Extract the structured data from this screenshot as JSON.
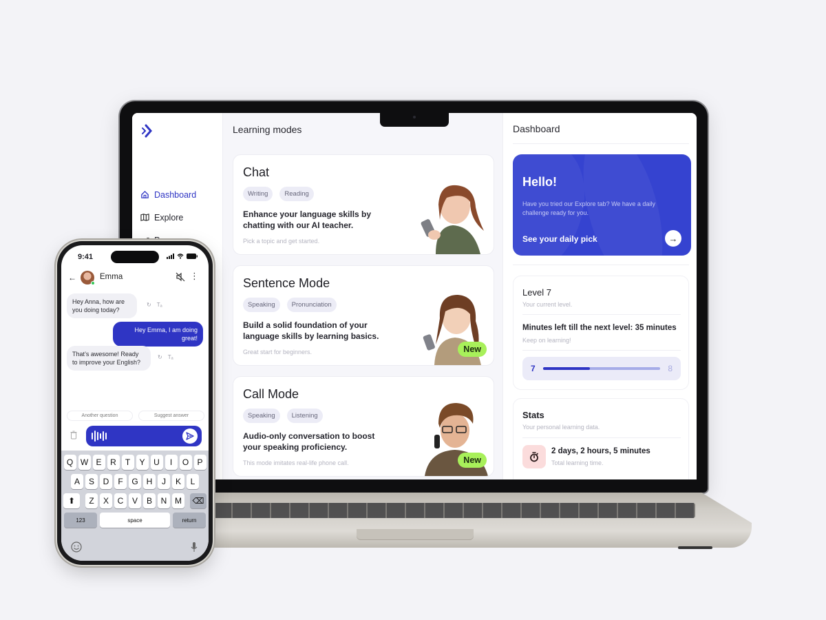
{
  "laptop": {
    "sidebar": {
      "logo": "app-logo",
      "items": [
        {
          "label": "Dashboard",
          "icon": "home-icon",
          "active": true
        },
        {
          "label": "Explore",
          "icon": "map-icon",
          "active": false
        },
        {
          "label": "Progress",
          "icon": "trend-up-icon",
          "active": false
        }
      ]
    },
    "learning_modes": {
      "title": "Learning modes",
      "cards": [
        {
          "title": "Chat",
          "tags": [
            "Writing",
            "Reading"
          ],
          "description": "Enhance your language skills by chatting with our AI teacher.",
          "hint": "Pick a topic and get started.",
          "badge": null
        },
        {
          "title": "Sentence Mode",
          "tags": [
            "Speaking",
            "Pronunciation"
          ],
          "description": "Build a solid foundation of your language skills by learning basics.",
          "hint": "Great start for beginners.",
          "badge": "New"
        },
        {
          "title": "Call Mode",
          "tags": [
            "Speaking",
            "Listening"
          ],
          "description": "Audio-only conversation to boost your speaking proficiency.",
          "hint": "This mode imitates real-life phone call.",
          "badge": "New"
        }
      ]
    },
    "dashboard": {
      "title": "Dashboard",
      "hello": {
        "title": "Hello!",
        "text": "Have you tried our Explore tab? We have a daily challenge ready for you.",
        "cta": "See your daily pick",
        "arrow": "→"
      },
      "level": {
        "title": "Level 7",
        "subtitle": "Your current level.",
        "minutes": "Minutes left till the next level: 35 minutes",
        "minutes_sub": "Keep on learning!",
        "from": "7",
        "to": "8",
        "progress_fraction": 0.4
      },
      "stats": {
        "title": "Stats",
        "subtitle": "Your personal learning data.",
        "value": "2 days, 2 hours, 5 minutes",
        "value_sub": "Total learning time.",
        "icon": "stopwatch-icon"
      }
    }
  },
  "phone": {
    "time": "9:41",
    "contact": "Emma",
    "messages": [
      {
        "from": "in",
        "text": "Hey Anna, how are you doing today?"
      },
      {
        "from": "out",
        "text": "Hey Emma, I am doing great!"
      },
      {
        "from": "in",
        "text": "That’s awesome! Ready to improve your English?"
      }
    ],
    "suggestions": [
      "Another question",
      "Suggest answer"
    ],
    "keyboard": {
      "row1": [
        "Q",
        "W",
        "E",
        "R",
        "T",
        "Y",
        "U",
        "I",
        "O",
        "P"
      ],
      "row2": [
        "A",
        "S",
        "D",
        "F",
        "G",
        "H",
        "J",
        "K",
        "L"
      ],
      "row3": [
        "Z",
        "X",
        "C",
        "V",
        "B",
        "N",
        "M"
      ],
      "numbers": "123",
      "space": "space",
      "return": "return"
    }
  }
}
